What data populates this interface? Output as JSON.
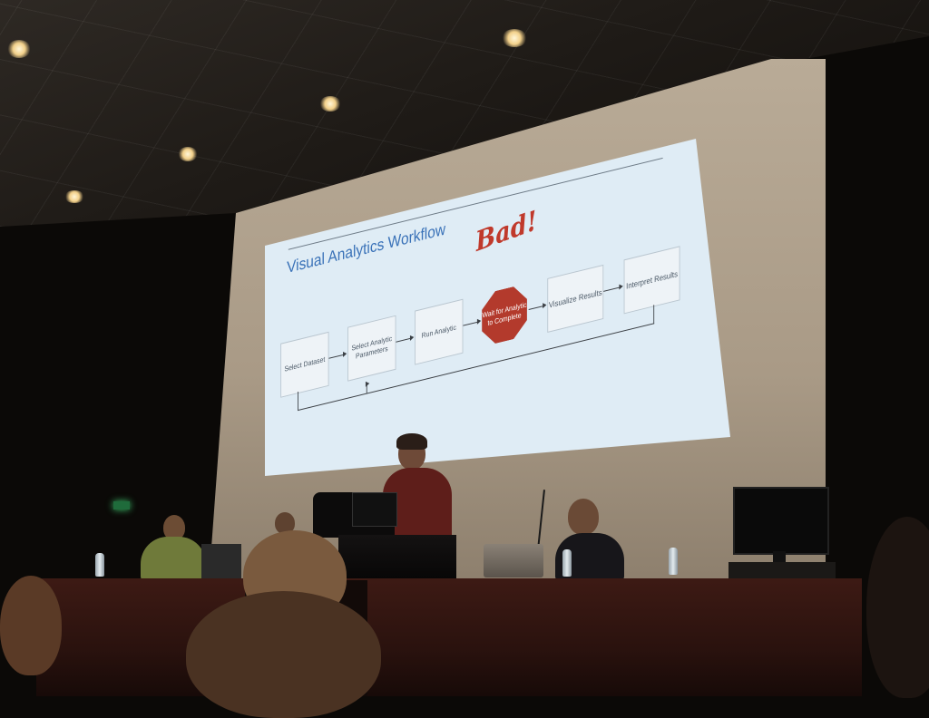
{
  "slide": {
    "title": "Visual Analytics Workflow",
    "annotation": "Bad!",
    "steps": [
      "Select Dataset",
      "Select Analytic Parameters",
      "Run Analytic",
      "Wait for Analytic to Complete",
      "Visualize Results",
      "Interpret Results"
    ]
  },
  "colors": {
    "slide_background": "#dfecf5",
    "title_blue": "#3a72b8",
    "stop_red": "#b33a2c",
    "tablecloth": "#3d1a14"
  }
}
